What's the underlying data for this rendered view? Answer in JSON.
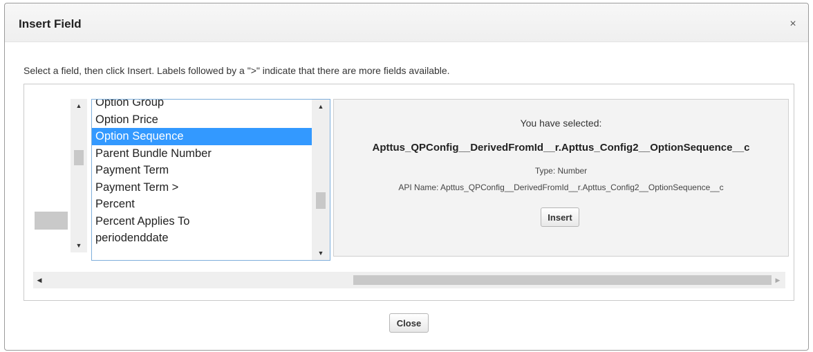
{
  "dialog": {
    "title": "Insert Field",
    "close_icon_char": "×"
  },
  "instructions": "Select a field, then click Insert. Labels followed by a \">\" indicate that there are more fields available.",
  "field_list": {
    "items": [
      {
        "label": "Option Group",
        "selected": false
      },
      {
        "label": "Option Price",
        "selected": false
      },
      {
        "label": "Option Sequence",
        "selected": true
      },
      {
        "label": "Parent Bundle Number",
        "selected": false
      },
      {
        "label": "Payment Term",
        "selected": false
      },
      {
        "label": "Payment Term >",
        "selected": false
      },
      {
        "label": "Percent",
        "selected": false
      },
      {
        "label": "Percent Applies To",
        "selected": false
      },
      {
        "label": "periodenddate",
        "selected": false
      }
    ]
  },
  "selection_info": {
    "heading": "You have selected:",
    "field_path": "Apttus_QPConfig__DerivedFromId__r.Apttus_Config2__OptionSequence__c",
    "type_line": "Type: Number",
    "api_line": "API Name: Apttus_QPConfig__DerivedFromId__r.Apttus_Config2__OptionSequence__c",
    "insert_label": "Insert"
  },
  "footer": {
    "close_label": "Close"
  },
  "icons": {
    "scroll_up": "▲",
    "scroll_down": "▼",
    "scroll_left": "◀",
    "scroll_right": "▶"
  },
  "colors": {
    "selection": "#3399ff",
    "listbox_border": "#7eaedb",
    "info_background": "#f3f3f3"
  }
}
